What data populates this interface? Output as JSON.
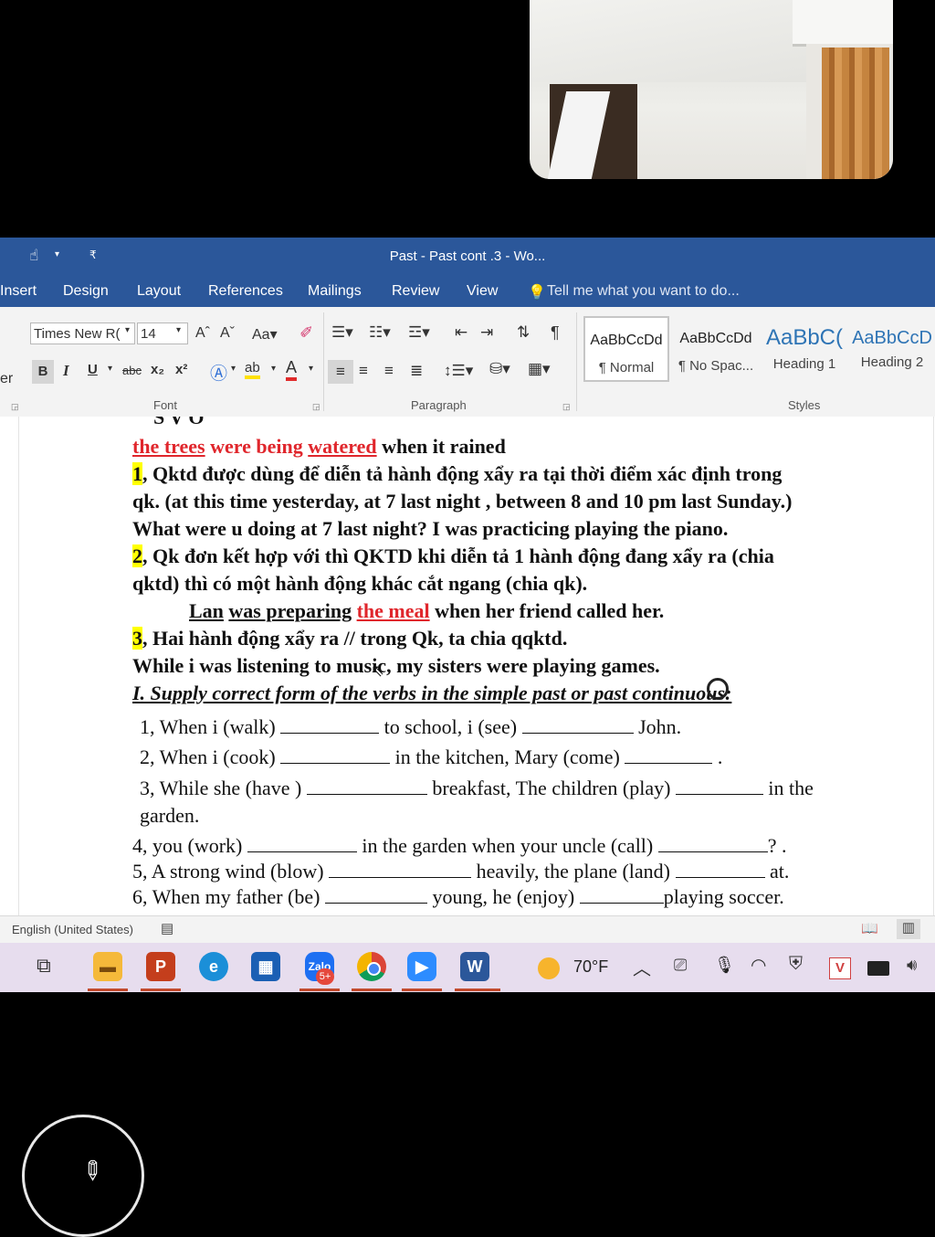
{
  "word": {
    "title": "Past - Past cont .3 - Wo...",
    "tabs": [
      "Insert",
      "Design",
      "Layout",
      "References",
      "Mailings",
      "Review",
      "View"
    ],
    "tell_me": "Tell me what you want to do...",
    "font_name": "Times New R(",
    "font_size": "14",
    "groups": {
      "font": "Font",
      "paragraph": "Paragraph",
      "styles": "Styles"
    },
    "cut_label": "er",
    "styles": [
      {
        "preview": "AaBbCcDd",
        "name": "¶ Normal"
      },
      {
        "preview": "AaBbCcDd",
        "name": "¶ No Spac..."
      },
      {
        "preview": "AaBbC(",
        "name": "Heading 1"
      },
      {
        "preview": "AaBbCcD",
        "name": "Heading 2"
      }
    ],
    "status_language": "English (United States)"
  },
  "document": {
    "top_cut": "S          V              O",
    "line1": {
      "red_u": "the trees",
      "red": " were being ",
      "red_u2": "watered",
      "rest": " when it rained"
    },
    "n1": "1",
    "p1": ", Qktd được dùng để diễn tả hành động xẩy ra tại thời điểm xác định trong",
    "p1b": "qk. (at this time yesterday, at 7 last night , between 8 and 10 pm last Sunday.)",
    "p1c": "What were u doing at 7 last night? I was practicing playing the piano.",
    "n2": "2",
    "p2": ",  Qk đơn kết hợp với thì QKTD khi diễn tả 1 hành động đang xẩy ra (chia",
    "p2b": "qktd) thì có một hành động khác cắt ngang (chia qk).",
    "ex2": {
      "u1": "Lan",
      "u2": "was preparing",
      "red_u": "the meal",
      "rest": " when her friend called her."
    },
    "n3": "3",
    "p3": ", Hai hành động xẩy ra // trong Qk, ta chia qqktd.",
    "p3b": "While i was listening to music, my sisters were playing games.",
    "heading": "I. Supply correct form of the verbs in the simple past or past continuous:",
    "ex": [
      {
        "a": "1, When i (walk)",
        "b": "to school, i (see)",
        "c": "John."
      },
      {
        "a": "2, When i (cook)",
        "b": "in the kitchen, Mary (come)",
        "c": "."
      },
      {
        "a": "3, While she (have )",
        "b": "breakfast, The children (play)",
        "c": "in the"
      },
      {
        "a": "garden."
      },
      {
        "a": "4, you (work)",
        "b": "in the garden when your uncle (call)",
        "c": "? ."
      },
      {
        "a": "5, A strong wind (blow)",
        "b": "heavily, the plane (land)",
        "c": "at."
      },
      {
        "a": "6, When my father (be)",
        "b": "young, he (enjoy)",
        "c": "playing soccer."
      }
    ]
  },
  "taskbar": {
    "weather": "70°F",
    "badge": "5+",
    "apps": [
      "task-view",
      "file-explorer",
      "powerpoint",
      "edge",
      "store",
      "zalo",
      "chrome",
      "zoom",
      "word"
    ]
  }
}
